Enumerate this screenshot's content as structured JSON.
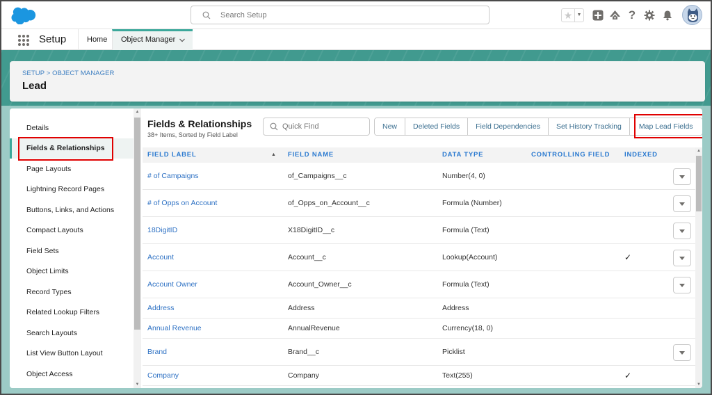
{
  "header": {
    "search_placeholder": "Search Setup",
    "icons": [
      "favorites-star-icon",
      "favorites-dropdown-icon",
      "global-add-icon",
      "trailhead-icon",
      "help-icon",
      "setup-gear-icon",
      "notifications-bell-icon",
      "user-avatar"
    ]
  },
  "context_bar": {
    "app_name": "Setup",
    "tabs": [
      {
        "label": "Home"
      },
      {
        "label": "Object Manager",
        "active": true
      }
    ]
  },
  "page_header": {
    "breadcrumb": "SETUP > OBJECT MANAGER",
    "title": "Lead"
  },
  "left_nav": {
    "items": [
      {
        "label": "Details"
      },
      {
        "label": "Fields & Relationships",
        "active": true,
        "highlighted": true
      },
      {
        "label": "Page Layouts"
      },
      {
        "label": "Lightning Record Pages"
      },
      {
        "label": "Buttons, Links, and Actions"
      },
      {
        "label": "Compact Layouts"
      },
      {
        "label": "Field Sets"
      },
      {
        "label": "Object Limits"
      },
      {
        "label": "Record Types"
      },
      {
        "label": "Related Lookup Filters"
      },
      {
        "label": "Search Layouts"
      },
      {
        "label": "List View Button Layout"
      },
      {
        "label": "Object Access"
      }
    ]
  },
  "content": {
    "title": "Fields & Relationships",
    "subtitle": "38+ Items, Sorted by Field Label",
    "quick_find_placeholder": "Quick Find",
    "buttons": [
      {
        "label": "New"
      },
      {
        "label": "Deleted Fields"
      },
      {
        "label": "Field Dependencies"
      },
      {
        "label": "Set History Tracking"
      },
      {
        "label": "Map Lead Fields",
        "highlighted": true
      }
    ],
    "columns": [
      "FIELD LABEL",
      "FIELD NAME",
      "DATA TYPE",
      "CONTROLLING FIELD",
      "INDEXED"
    ],
    "sort_indicator": "▲",
    "rows": [
      {
        "label": "# of Campaigns",
        "name": "of_Campaigns__c",
        "type": "Number(4, 0)",
        "controlling": "",
        "indexed": false,
        "menu": true
      },
      {
        "label": "# of Opps on Account",
        "name": "of_Opps_on_Account__c",
        "type": "Formula (Number)",
        "controlling": "",
        "indexed": false,
        "menu": true
      },
      {
        "label": "18DigitID",
        "name": "X18DigitID__c",
        "type": "Formula (Text)",
        "controlling": "",
        "indexed": false,
        "menu": true
      },
      {
        "label": "Account",
        "name": "Account__c",
        "type": "Lookup(Account)",
        "controlling": "",
        "indexed": true,
        "menu": true
      },
      {
        "label": "Account Owner",
        "name": "Account_Owner__c",
        "type": "Formula (Text)",
        "controlling": "",
        "indexed": false,
        "menu": true
      },
      {
        "label": "Address",
        "name": "Address",
        "type": "Address",
        "controlling": "",
        "indexed": false,
        "menu": false
      },
      {
        "label": "Annual Revenue",
        "name": "AnnualRevenue",
        "type": "Currency(18, 0)",
        "controlling": "",
        "indexed": false,
        "menu": false
      },
      {
        "label": "Brand",
        "name": "Brand__c",
        "type": "Picklist",
        "controlling": "",
        "indexed": false,
        "menu": true
      },
      {
        "label": "Company",
        "name": "Company",
        "type": "Text(255)",
        "controlling": "",
        "indexed": true,
        "menu": false
      }
    ],
    "check_glyph": "✓"
  },
  "colors": {
    "brand_blue": "#1b96e0",
    "accent_teal": "#3ba89b",
    "link_blue": "#2f72c4",
    "highlight_red": "#e00000"
  }
}
